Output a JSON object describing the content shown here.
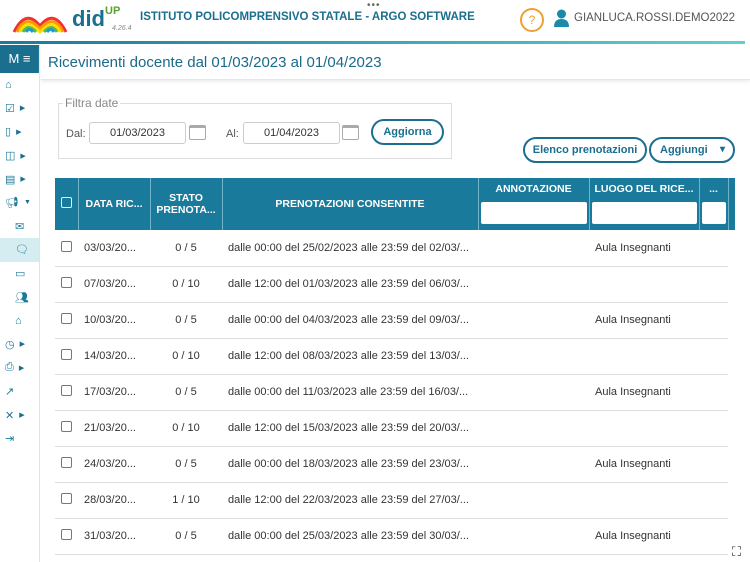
{
  "header": {
    "brand": "did",
    "brand_sup": "UP",
    "version": "4.26.4",
    "school": "ISTITUTO POLICOMPRENSIVO STATALE - ARGO SOFTWARE",
    "help": "?",
    "user": "GIANLUCA.ROSSI.DEMO2022"
  },
  "sidebar": {
    "menu_label": "M ≡"
  },
  "page": {
    "title": "Ricevimenti docente dal 01/03/2023 al 01/04/2023"
  },
  "filter": {
    "legend": "Filtra date",
    "from_label": "Dal:",
    "from_value": "01/03/2023",
    "to_label": "Al:",
    "to_value": "01/04/2023",
    "refresh": "Aggiorna"
  },
  "actions": {
    "list": "Elenco prenotazioni",
    "add": "Aggiungi",
    "add_caret": "▾"
  },
  "table": {
    "headers": [
      "DATA RIC...",
      "STATO PRENOTA...",
      "PRENOTAZIONI CONSENTITE",
      "ANNOTAZIONE",
      "LUOGO DEL RICE...",
      "..."
    ],
    "rows": [
      {
        "date": "03/03/20...",
        "status": "0 / 5",
        "allowed": "dalle 00:00 del 25/02/2023 alle 23:59 del 02/03/...",
        "note": "",
        "place": "Aula Insegnanti"
      },
      {
        "date": "07/03/20...",
        "status": "0 / 10",
        "allowed": "dalle 12:00 del 01/03/2023 alle 23:59 del 06/03/...",
        "note": "",
        "place": ""
      },
      {
        "date": "10/03/20...",
        "status": "0 / 5",
        "allowed": "dalle 00:00 del 04/03/2023 alle 23:59 del 09/03/...",
        "note": "",
        "place": "Aula Insegnanti"
      },
      {
        "date": "14/03/20...",
        "status": "0 / 10",
        "allowed": "dalle 12:00 del 08/03/2023 alle 23:59 del 13/03/...",
        "note": "",
        "place": ""
      },
      {
        "date": "17/03/20...",
        "status": "0 / 5",
        "allowed": "dalle 00:00 del 11/03/2023 alle 23:59 del 16/03/...",
        "note": "",
        "place": "Aula Insegnanti"
      },
      {
        "date": "21/03/20...",
        "status": "0 / 10",
        "allowed": "dalle 12:00 del 15/03/2023 alle 23:59 del 20/03/...",
        "note": "",
        "place": ""
      },
      {
        "date": "24/03/20...",
        "status": "0 / 5",
        "allowed": "dalle 00:00 del 18/03/2023 alle 23:59 del 23/03/...",
        "note": "",
        "place": "Aula Insegnanti"
      },
      {
        "date": "28/03/20...",
        "status": "1 / 10",
        "allowed": "dalle 12:00 del 22/03/2023 alle 23:59 del 27/03/...",
        "note": "",
        "place": ""
      },
      {
        "date": "31/03/20...",
        "status": "0 / 5",
        "allowed": "dalle 00:00 del 25/03/2023 alle 23:59 del 30/03/...",
        "note": "",
        "place": "Aula Insegnanti"
      }
    ]
  }
}
